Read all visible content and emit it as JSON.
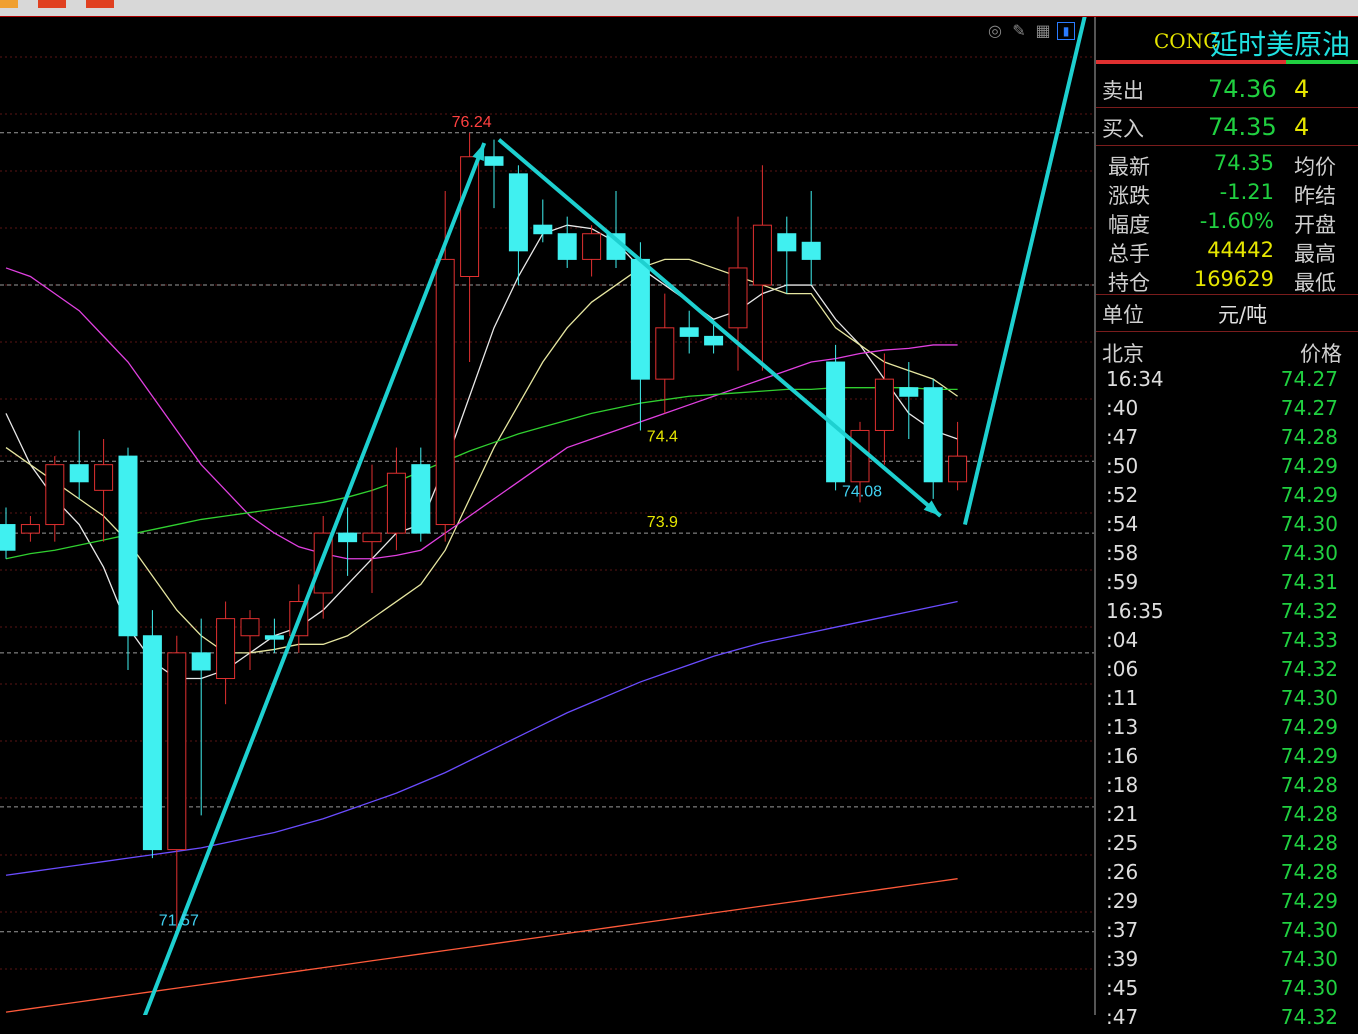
{
  "panel": {
    "code": "CONC",
    "name": "延时美原油",
    "sell": {
      "label": "卖出",
      "price": "74.36",
      "qty": "4"
    },
    "buy": {
      "label": "买入",
      "price": "74.35",
      "qty": "4"
    },
    "stats": [
      {
        "label": "最新",
        "value": "74.35",
        "color": "#20d040",
        "right": "均价"
      },
      {
        "label": "涨跌",
        "value": "-1.21",
        "color": "#20d040",
        "right": "昨结"
      },
      {
        "label": "幅度",
        "value": "-1.60%",
        "color": "#20d040",
        "right": "开盘"
      },
      {
        "label": "总手",
        "value": "44442",
        "color": "#e6e600",
        "right": "最高"
      },
      {
        "label": "持仓",
        "value": "169629",
        "color": "#e6e600",
        "right": "最低"
      }
    ],
    "unit_label": "单位",
    "unit_value": "元/吨",
    "ticks_header": {
      "time": "北京",
      "price": "价格"
    },
    "ticks": [
      {
        "time": "16:34",
        "price": "74.27"
      },
      {
        "time": ":40",
        "price": "74.27"
      },
      {
        "time": ":47",
        "price": "74.28"
      },
      {
        "time": ":50",
        "price": "74.29"
      },
      {
        "time": ":52",
        "price": "74.29"
      },
      {
        "time": ":54",
        "price": "74.30"
      },
      {
        "time": ":58",
        "price": "74.30"
      },
      {
        "time": ":59",
        "price": "74.31"
      },
      {
        "time": "16:35",
        "price": "74.32"
      },
      {
        "time": ":04",
        "price": "74.33"
      },
      {
        "time": ":06",
        "price": "74.32"
      },
      {
        "time": ":11",
        "price": "74.30"
      },
      {
        "time": ":13",
        "price": "74.29"
      },
      {
        "time": ":16",
        "price": "74.29"
      },
      {
        "time": ":18",
        "price": "74.28"
      },
      {
        "time": ":21",
        "price": "74.28"
      },
      {
        "time": ":25",
        "price": "74.28"
      },
      {
        "time": ":26",
        "price": "74.28"
      },
      {
        "time": ":29",
        "price": "74.29"
      },
      {
        "time": ":37",
        "price": "74.30"
      },
      {
        "time": ":39",
        "price": "74.30"
      },
      {
        "time": ":45",
        "price": "74.30"
      },
      {
        "time": ":47",
        "price": "74.32"
      }
    ]
  },
  "toolbar": {
    "icons": [
      "eye-off-icon",
      "pencil-icon",
      "grid-icon",
      "panel-toggle-icon"
    ]
  },
  "chart_data": {
    "type": "candlestick",
    "ylim": [
      71.2,
      76.8
    ],
    "hlines": [
      76.24,
      75.35,
      74.32,
      73.9,
      73.2,
      72.3,
      71.57
    ],
    "colors": {
      "up": "#e03030",
      "down": "#40f0f0",
      "ma5": "#e8e8e8",
      "ma10": "#e6e6a0",
      "ma20": "#e040e0",
      "ma60": "#30d030",
      "ma120": "#6a4cff",
      "ma250": "#ff5a3a",
      "arrow": "#1ed0d0"
    },
    "candles": [
      {
        "o": 73.95,
        "h": 74.05,
        "l": 73.75,
        "c": 73.8
      },
      {
        "o": 73.9,
        "h": 74.0,
        "l": 73.85,
        "c": 73.95
      },
      {
        "o": 73.95,
        "h": 74.35,
        "l": 73.85,
        "c": 74.3
      },
      {
        "o": 74.3,
        "h": 74.5,
        "l": 74.1,
        "c": 74.2
      },
      {
        "o": 74.15,
        "h": 74.45,
        "l": 73.85,
        "c": 74.3
      },
      {
        "o": 74.35,
        "h": 74.4,
        "l": 73.1,
        "c": 73.3
      },
      {
        "o": 73.3,
        "h": 73.45,
        "l": 72.0,
        "c": 72.05
      },
      {
        "o": 72.05,
        "h": 73.3,
        "l": 71.57,
        "c": 73.2
      },
      {
        "o": 73.2,
        "h": 73.4,
        "l": 72.25,
        "c": 73.1
      },
      {
        "o": 73.05,
        "h": 73.5,
        "l": 72.9,
        "c": 73.4
      },
      {
        "o": 73.3,
        "h": 73.45,
        "l": 73.1,
        "c": 73.4
      },
      {
        "o": 73.3,
        "h": 73.4,
        "l": 73.2,
        "c": 73.28
      },
      {
        "o": 73.3,
        "h": 73.6,
        "l": 73.2,
        "c": 73.5
      },
      {
        "o": 73.55,
        "h": 74.0,
        "l": 73.4,
        "c": 73.9
      },
      {
        "o": 73.9,
        "h": 74.05,
        "l": 73.65,
        "c": 73.85
      },
      {
        "o": 73.85,
        "h": 74.3,
        "l": 73.55,
        "c": 73.9
      },
      {
        "o": 73.9,
        "h": 74.4,
        "l": 73.8,
        "c": 74.25
      },
      {
        "o": 74.3,
        "h": 74.4,
        "l": 73.85,
        "c": 73.9
      },
      {
        "o": 73.95,
        "h": 75.9,
        "l": 73.85,
        "c": 75.5
      },
      {
        "o": 75.4,
        "h": 76.24,
        "l": 74.9,
        "c": 76.1
      },
      {
        "o": 76.1,
        "h": 76.2,
        "l": 75.8,
        "c": 76.05
      },
      {
        "o": 76.0,
        "h": 76.05,
        "l": 75.35,
        "c": 75.55
      },
      {
        "o": 75.7,
        "h": 75.85,
        "l": 75.6,
        "c": 75.65
      },
      {
        "o": 75.65,
        "h": 75.75,
        "l": 75.45,
        "c": 75.5
      },
      {
        "o": 75.5,
        "h": 75.7,
        "l": 75.4,
        "c": 75.65
      },
      {
        "o": 75.65,
        "h": 75.9,
        "l": 75.45,
        "c": 75.5
      },
      {
        "o": 75.5,
        "h": 75.6,
        "l": 74.5,
        "c": 74.8
      },
      {
        "o": 74.8,
        "h": 75.3,
        "l": 74.6,
        "c": 75.1
      },
      {
        "o": 75.1,
        "h": 75.2,
        "l": 74.95,
        "c": 75.05
      },
      {
        "o": 75.05,
        "h": 75.15,
        "l": 74.95,
        "c": 75.0
      },
      {
        "o": 75.1,
        "h": 75.75,
        "l": 74.85,
        "c": 75.45
      },
      {
        "o": 75.35,
        "h": 76.05,
        "l": 74.85,
        "c": 75.7
      },
      {
        "o": 75.65,
        "h": 75.75,
        "l": 75.3,
        "c": 75.55
      },
      {
        "o": 75.6,
        "h": 75.9,
        "l": 75.35,
        "c": 75.5
      },
      {
        "o": 74.9,
        "h": 75.0,
        "l": 74.15,
        "c": 74.2
      },
      {
        "o": 74.2,
        "h": 74.55,
        "l": 74.08,
        "c": 74.5
      },
      {
        "o": 74.5,
        "h": 74.95,
        "l": 74.3,
        "c": 74.8
      },
      {
        "o": 74.75,
        "h": 74.9,
        "l": 74.45,
        "c": 74.7
      },
      {
        "o": 74.75,
        "h": 74.8,
        "l": 74.1,
        "c": 74.2
      },
      {
        "o": 74.2,
        "h": 74.55,
        "l": 74.15,
        "c": 74.35
      }
    ],
    "ma": {
      "ma5": [
        74.6,
        74.3,
        74.1,
        73.95,
        73.7,
        73.35,
        73.15,
        73.05,
        73.05,
        73.1,
        73.2,
        73.3,
        73.35,
        73.45,
        73.6,
        73.75,
        73.9,
        73.95,
        74.3,
        74.7,
        75.1,
        75.4,
        75.65,
        75.7,
        75.68,
        75.6,
        75.45,
        75.35,
        75.25,
        75.15,
        75.2,
        75.3,
        75.35,
        75.35,
        75.15,
        75.0,
        74.8,
        74.6,
        74.5,
        74.45
      ],
      "ma10": [
        74.4,
        74.3,
        74.2,
        74.1,
        74.0,
        73.85,
        73.65,
        73.45,
        73.3,
        73.2,
        73.2,
        73.22,
        73.25,
        73.25,
        73.3,
        73.4,
        73.5,
        73.6,
        73.8,
        74.1,
        74.4,
        74.65,
        74.9,
        75.1,
        75.25,
        75.35,
        75.45,
        75.5,
        75.5,
        75.45,
        75.4,
        75.35,
        75.3,
        75.3,
        75.1,
        75.0,
        74.9,
        74.85,
        74.8,
        74.7
      ],
      "ma20": [
        75.45,
        75.4,
        75.3,
        75.2,
        75.05,
        74.9,
        74.7,
        74.5,
        74.3,
        74.15,
        74.0,
        73.9,
        73.82,
        73.78,
        73.75,
        73.75,
        73.77,
        73.8,
        73.9,
        74.0,
        74.1,
        74.2,
        74.3,
        74.4,
        74.45,
        74.5,
        74.55,
        74.6,
        74.65,
        74.7,
        74.75,
        74.8,
        74.85,
        74.9,
        74.92,
        74.95,
        74.97,
        74.98,
        75.0,
        75.0
      ],
      "ma60": [
        73.75,
        73.78,
        73.8,
        73.83,
        73.86,
        73.89,
        73.92,
        73.95,
        73.98,
        74.0,
        74.02,
        74.04,
        74.06,
        74.08,
        74.11,
        74.15,
        74.2,
        74.26,
        74.32,
        74.38,
        74.43,
        74.48,
        74.52,
        74.56,
        74.6,
        74.63,
        74.66,
        74.68,
        74.7,
        74.71,
        74.72,
        74.73,
        74.74,
        74.74,
        74.75,
        74.75,
        74.75,
        74.75,
        74.74,
        74.74
      ],
      "ma120": [
        71.9,
        71.92,
        71.94,
        71.96,
        71.98,
        72.0,
        72.02,
        72.04,
        72.06,
        72.09,
        72.12,
        72.15,
        72.19,
        72.23,
        72.28,
        72.33,
        72.38,
        72.44,
        72.5,
        72.57,
        72.64,
        72.71,
        72.78,
        72.85,
        72.91,
        72.97,
        73.03,
        73.08,
        73.13,
        73.18,
        73.22,
        73.26,
        73.29,
        73.32,
        73.35,
        73.38,
        73.41,
        73.44,
        73.47,
        73.5
      ],
      "ma250": [
        71.1,
        71.12,
        71.14,
        71.16,
        71.18,
        71.2,
        71.22,
        71.24,
        71.26,
        71.28,
        71.3,
        71.32,
        71.34,
        71.36,
        71.38,
        71.4,
        71.42,
        71.44,
        71.46,
        71.48,
        71.5,
        71.52,
        71.54,
        71.56,
        71.58,
        71.6,
        71.62,
        71.64,
        71.66,
        71.68,
        71.7,
        71.72,
        71.74,
        71.76,
        71.78,
        71.8,
        71.82,
        71.84,
        71.86,
        71.88
      ]
    },
    "annotations": [
      {
        "text": "76.24",
        "x": 19,
        "y": 76.24,
        "color": "#ff4040"
      },
      {
        "text": "71.57",
        "x": 7,
        "y": 71.57,
        "color": "#40d0f0"
      },
      {
        "text": "74.08",
        "x": 35,
        "y": 74.08,
        "color": "#40d0f0"
      },
      {
        "text": "74.4",
        "x": 27,
        "y": 74.4,
        "color": "#e6e600"
      },
      {
        "text": "73.9",
        "x": 27,
        "y": 73.9,
        "color": "#e6e600"
      }
    ],
    "arrows": [
      {
        "from": [
          5.2,
          70.9
        ],
        "to": [
          19.6,
          76.18
        ]
      },
      {
        "from": [
          20.2,
          76.2
        ],
        "to": [
          38.3,
          74.0
        ]
      },
      {
        "from": [
          39.3,
          73.95
        ],
        "to": [
          49.3,
          80.0
        ]
      }
    ]
  }
}
